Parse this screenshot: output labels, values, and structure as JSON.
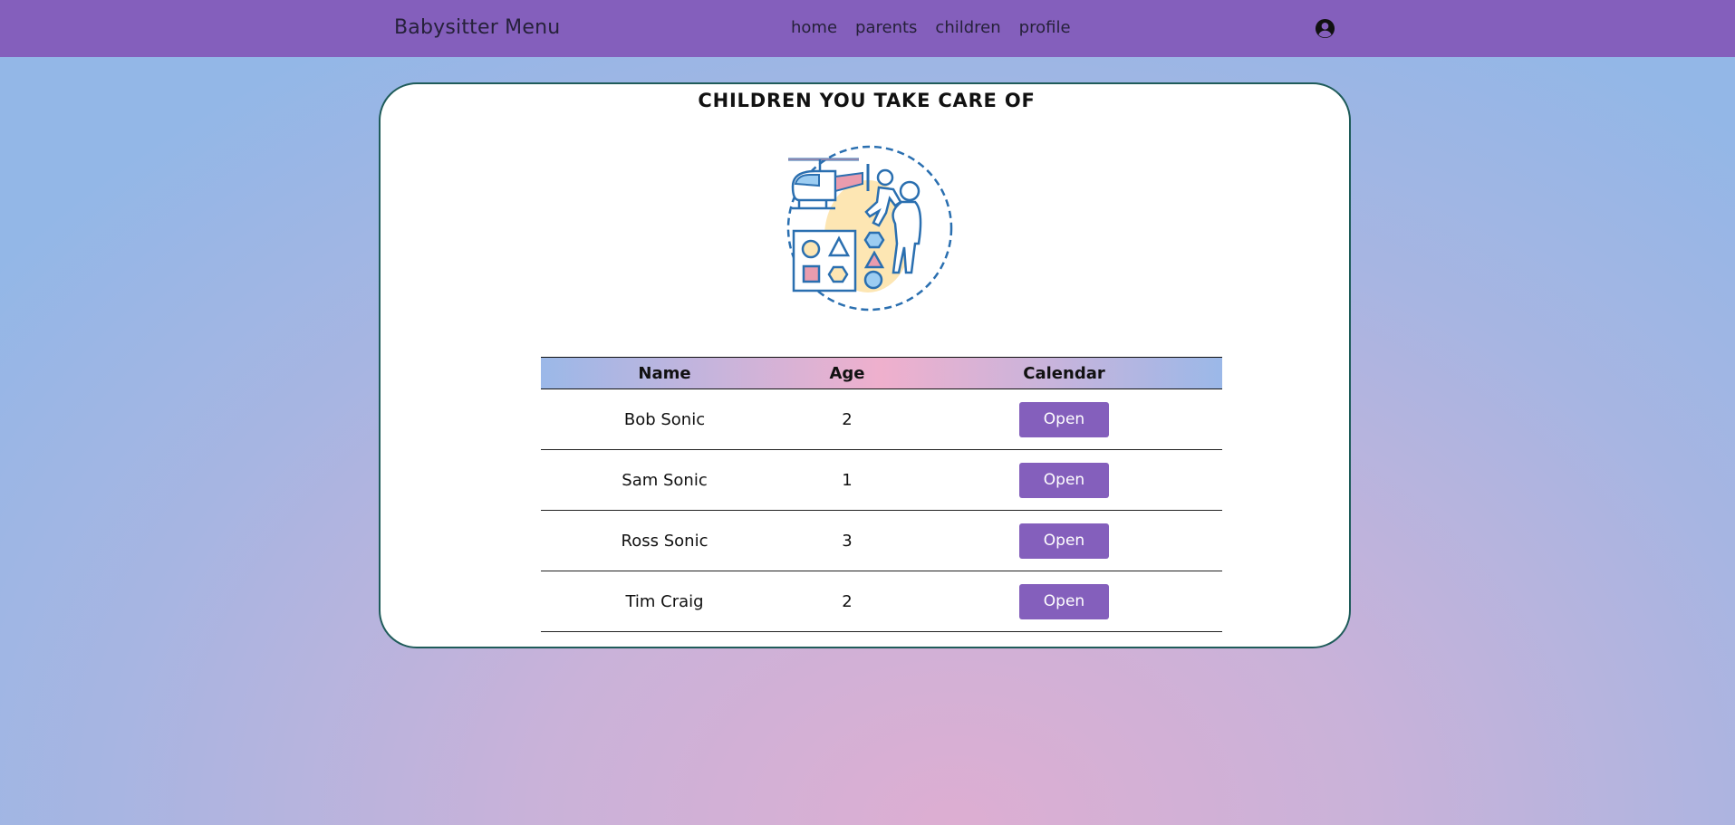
{
  "navbar": {
    "brand": "Babysitter Menu",
    "links": [
      {
        "label": "home"
      },
      {
        "label": "parents"
      },
      {
        "label": "children"
      },
      {
        "label": "profile"
      }
    ],
    "profile_icon": "user-circle-icon"
  },
  "main": {
    "title": "CHILDREN YOU TAKE CARE OF",
    "illustration_icon": "babysitter-playing-illustration",
    "table": {
      "headers": [
        "Name",
        "Age",
        "Calendar"
      ],
      "rows": [
        {
          "name": "Bob Sonic",
          "age": "2",
          "action": "Open"
        },
        {
          "name": "Sam Sonic",
          "age": "1",
          "action": "Open"
        },
        {
          "name": "Ross Sonic",
          "age": "3",
          "action": "Open"
        },
        {
          "name": "Tim Craig",
          "age": "2",
          "action": "Open"
        }
      ]
    }
  },
  "colors": {
    "accent": "#845fbc",
    "card_border": "#1f5c5a"
  }
}
